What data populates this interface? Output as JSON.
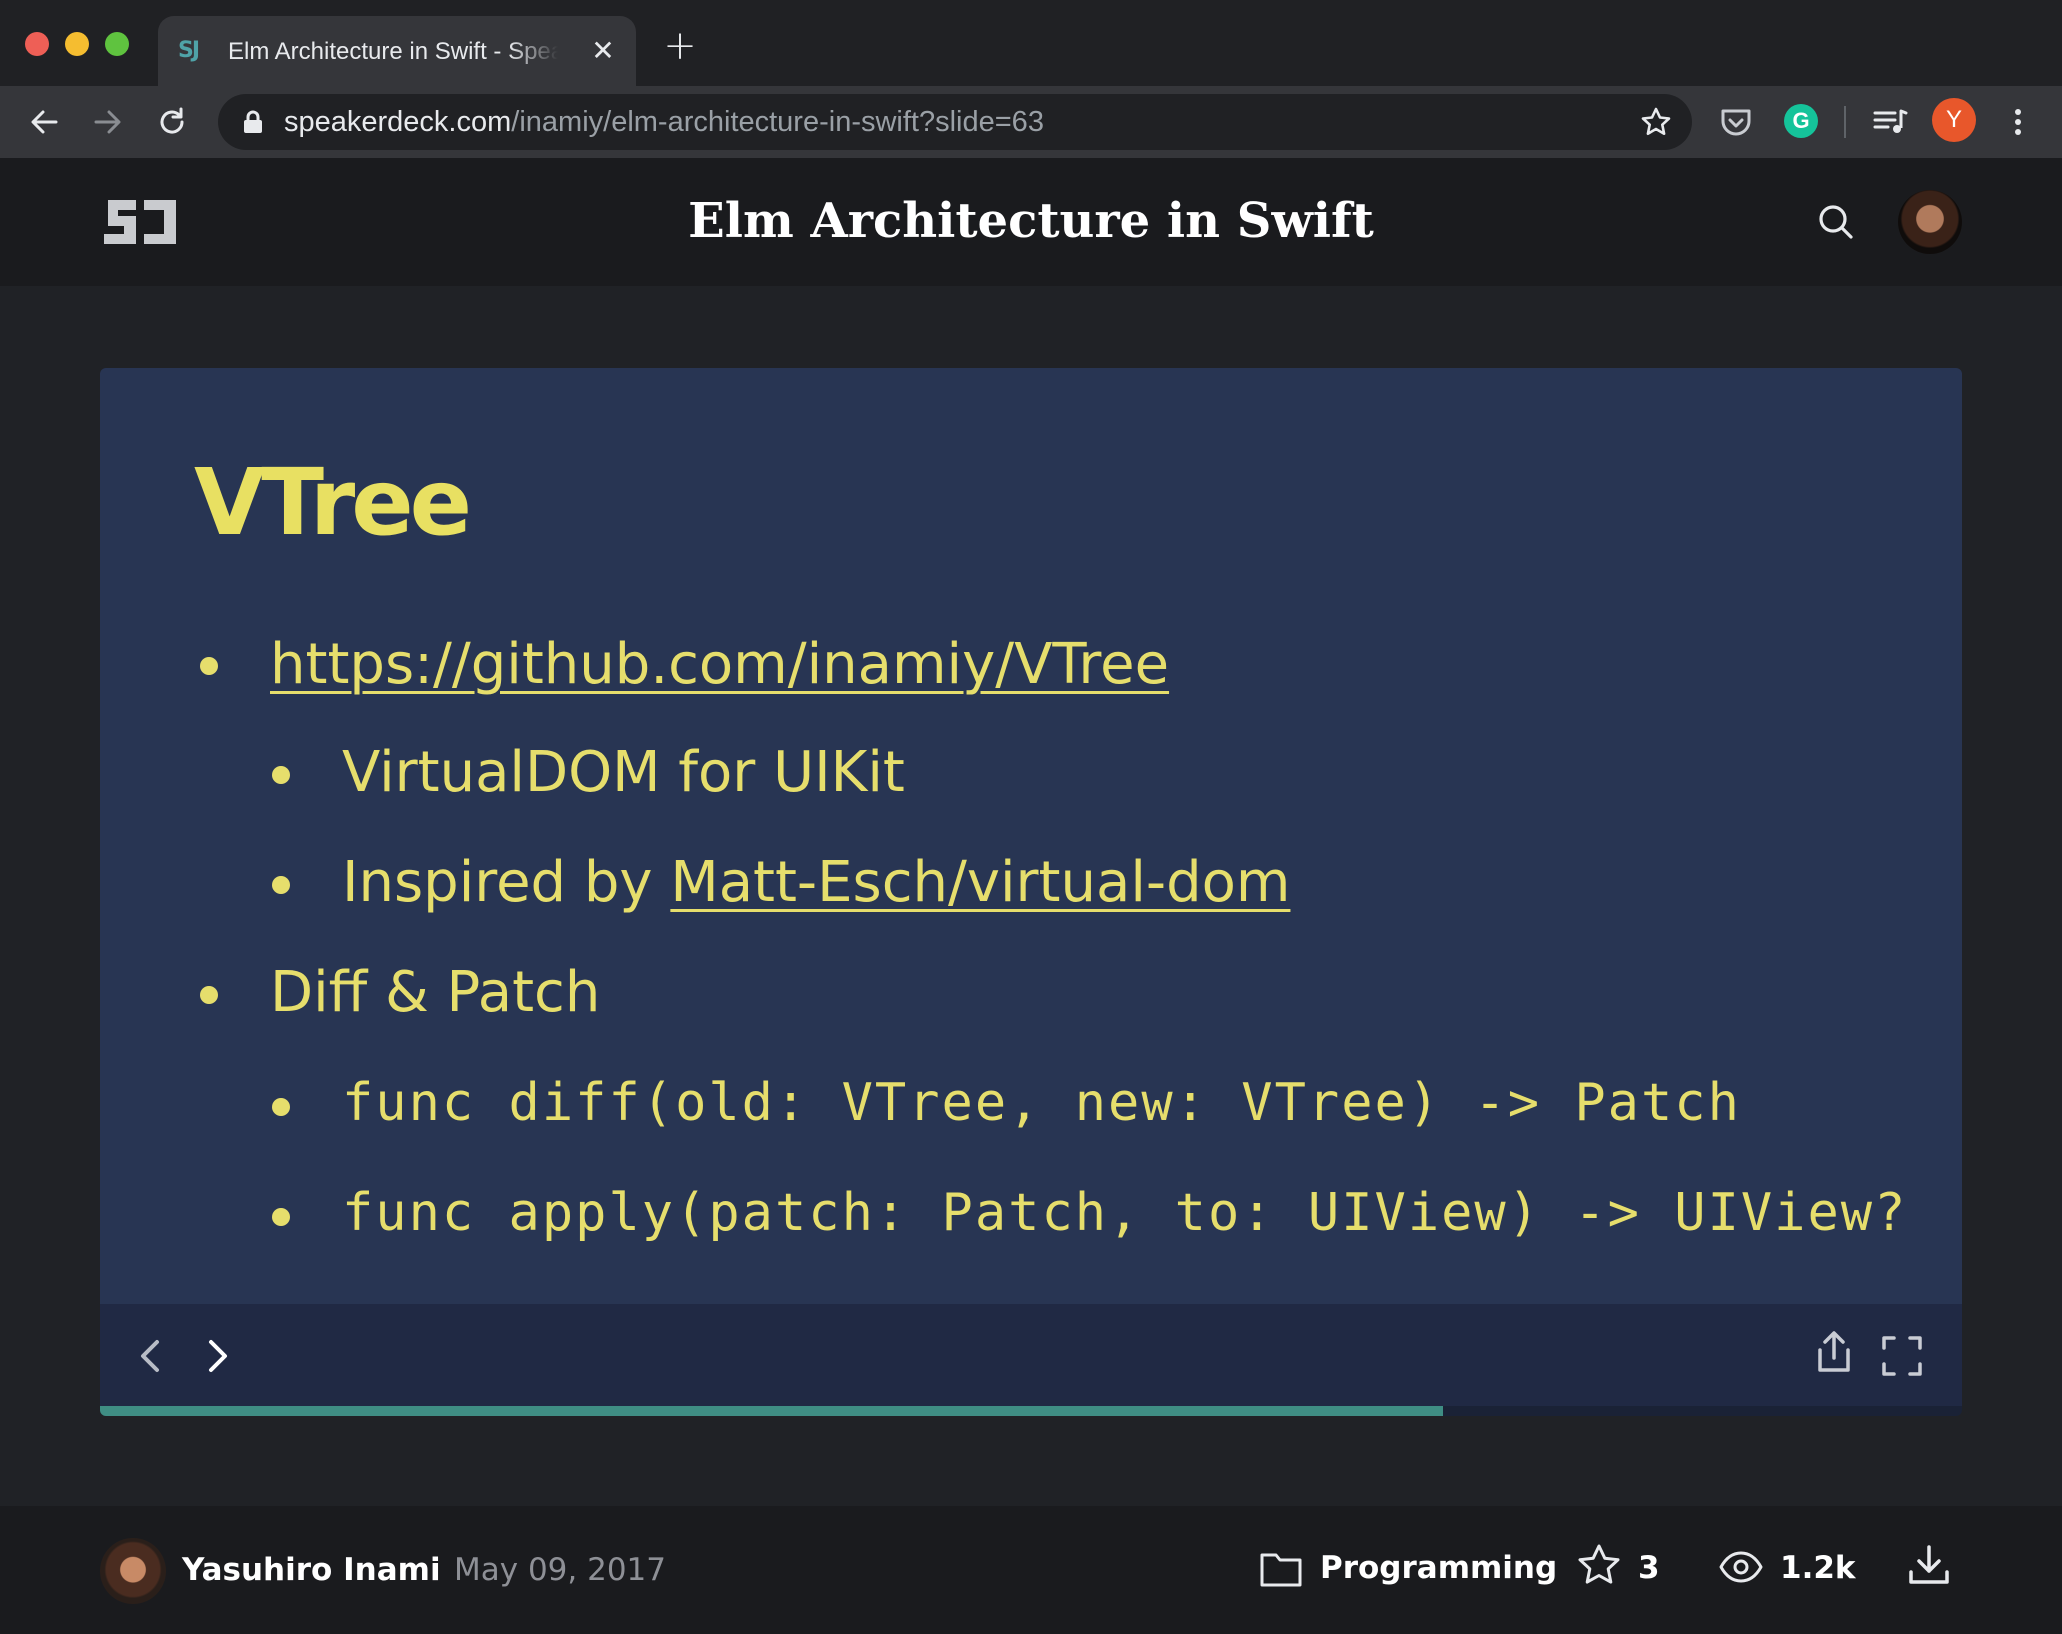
{
  "browser": {
    "tab_title": "Elm Architecture in Swift - Speaker Deck",
    "tab_favicon": "SJ",
    "close_glyph": "✕",
    "new_tab_glyph": "+",
    "url_host": "speakerdeck.com",
    "url_path": "/inamiy/elm-architecture-in-swift?slide=63",
    "profile_initial": "Y",
    "grammarly_letter": "G"
  },
  "site": {
    "title": "Elm Architecture in Swift"
  },
  "slide": {
    "heading": "VTree",
    "bullets": [
      {
        "text": "https://github.com/inamiy/VTree"
      },
      {
        "text": "VirtualDOM for UIKit"
      },
      {
        "prefix": "Inspired by ",
        "link": "Matt-Esch/virtual-dom"
      },
      {
        "text": "Diff & Patch"
      },
      {
        "text": "func diff(old: VTree, new: VTree) -> Patch"
      },
      {
        "text": "func apply(patch: Patch, to: UIView) -> UIView?"
      }
    ],
    "progress_fraction": 0.721
  },
  "footer": {
    "author": "Yasuhiro Inami",
    "date": "May 09, 2017",
    "category": "Programming",
    "stars": "3",
    "views": "1.2k"
  },
  "colors": {
    "slide_bg": "#283553",
    "slide_text": "#e6de6c",
    "progress": "#3f8e84"
  },
  "icons": [
    "back-arrow-icon",
    "forward-arrow-icon",
    "reload-icon",
    "lock-icon",
    "bookmark-star-icon",
    "pocket-icon",
    "grammarly-icon",
    "media-queue-icon",
    "kebab-menu-icon",
    "search-icon",
    "prev-slide-icon",
    "next-slide-icon",
    "share-icon",
    "fullscreen-icon",
    "folder-icon",
    "star-icon",
    "eye-icon",
    "download-icon"
  ]
}
